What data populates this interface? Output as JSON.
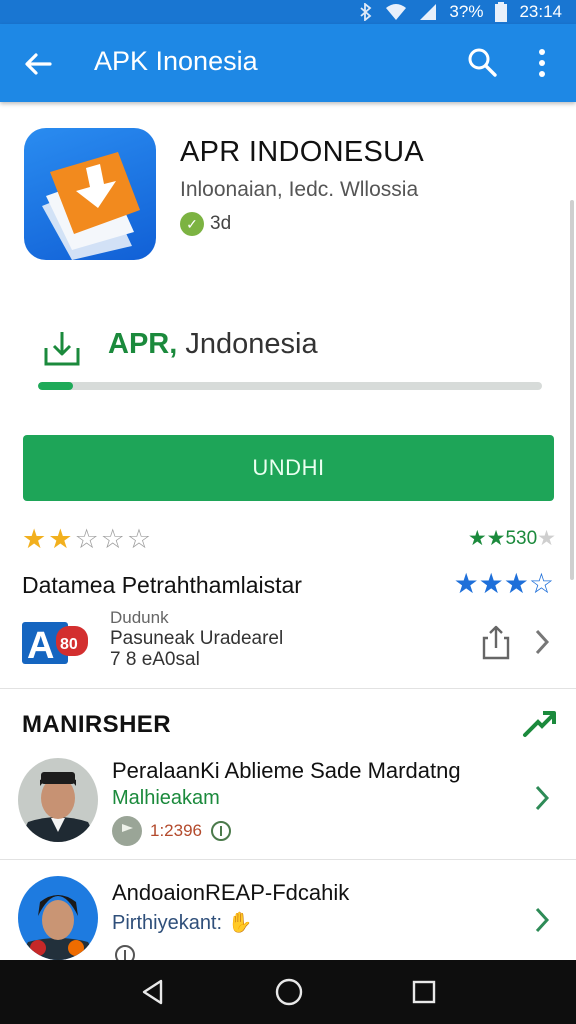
{
  "status": {
    "battery_text": "3?%",
    "time": "23:14"
  },
  "appbar": {
    "title": "APK Inonesia"
  },
  "app": {
    "title": "APR INDONESUA",
    "subtitle": "Inloonaian, Iedc. Wllossia",
    "badge_text": "3d"
  },
  "download": {
    "label_bold": "APR,",
    "label_rest": " Jndonesia",
    "progress": 0.07
  },
  "install_button": {
    "label": "UNDHI"
  },
  "rating": {
    "stars_filled": 2,
    "stars_total": 5,
    "right_count": "530",
    "right_stars_filled": 2
  },
  "developer": {
    "name": "Datamea Petrahthamlaistar",
    "stars_filled": 3,
    "stars_total": 4,
    "line1": "Dudunk",
    "line2": "Pasuneak Uradearel",
    "line3": "7 8 eA0sal"
  },
  "section": {
    "title": "MANIRSHER"
  },
  "items": [
    {
      "title": "PeralaanKi Ablieme Sade Mardatng",
      "subtitle": "Malhieakam",
      "meta": "1:2396"
    },
    {
      "title": "AndoaionREAP-Fdcahik",
      "subtitle": "Pirthiyekant:",
      "meta": ""
    }
  ],
  "colors": {
    "appbar": "#1e88e5",
    "statusbar": "#1976d2",
    "install": "#1ea558",
    "accent_green": "#1b8a3c",
    "star_gold": "#f2b01e",
    "star_blue": "#1e6fd9"
  },
  "icons": {
    "back": "arrow-left-icon",
    "search": "search-icon",
    "more": "more-vert-icon",
    "download": "download-icon",
    "share": "share-icon",
    "chevron": "chevron-right-icon",
    "trend": "trending-up-icon",
    "nav_back": "triangle-back-icon",
    "nav_home": "circle-home-icon",
    "nav_recents": "square-recents-icon"
  }
}
